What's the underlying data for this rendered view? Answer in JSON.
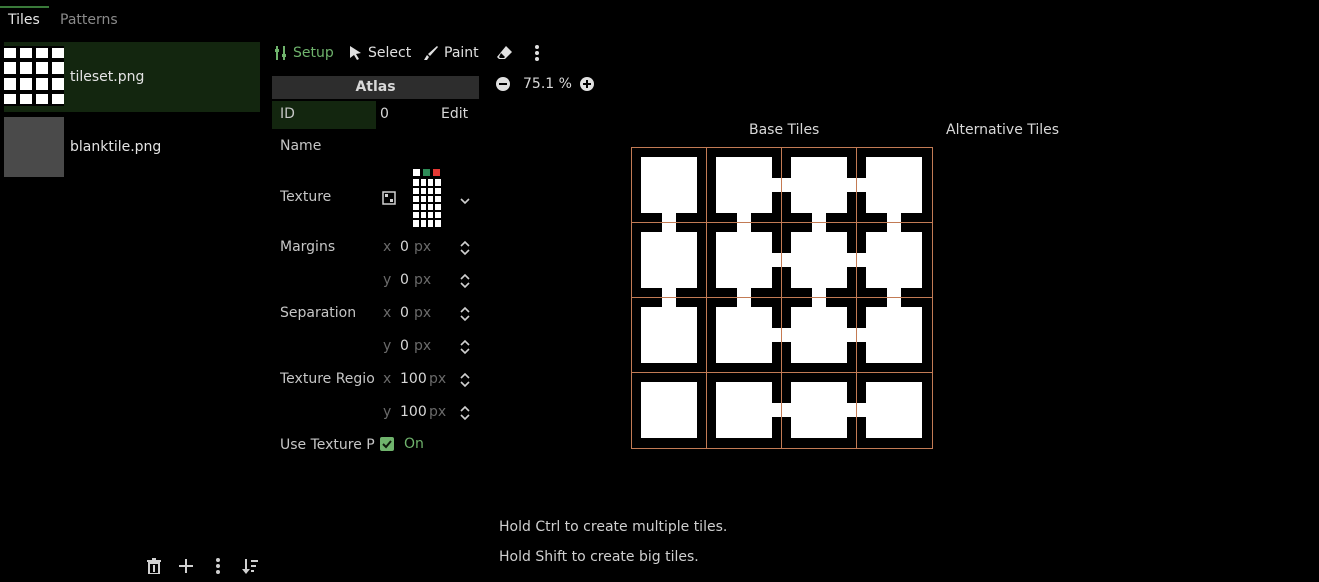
{
  "tabs": [
    {
      "label": "Tiles",
      "active": true
    },
    {
      "label": "Patterns",
      "active": false
    }
  ],
  "sources": [
    {
      "label": "tileset.png",
      "selected": true
    },
    {
      "label": "blanktile.png",
      "selected": false
    }
  ],
  "toolbar": {
    "setup": "Setup",
    "select": "Select",
    "paint": "Paint"
  },
  "zoom": {
    "value": "75.1 %"
  },
  "inspector": {
    "header": "Atlas",
    "id_label": "ID",
    "id_value": "0",
    "edit_label": "Edit",
    "name_label": "Name",
    "texture_label": "Texture",
    "margins_label": "Margins",
    "separation_label": "Separation",
    "texture_region_label": "Texture Regio",
    "use_texture_label": "Use Texture P",
    "use_texture_state": "On",
    "axis_x": "x",
    "axis_y": "y",
    "unit": "px",
    "margins": {
      "x": "0",
      "y": "0"
    },
    "separation": {
      "x": "0",
      "y": "0"
    },
    "texture_region": {
      "x": "100",
      "y": "100"
    }
  },
  "atlas_view": {
    "base_tiles_label": "Base Tiles",
    "alternative_tiles_label": "Alternative Tiles"
  },
  "hints": [
    "Hold Ctrl to create multiple tiles.",
    "Hold Shift to create big tiles."
  ],
  "colors": {
    "accent": "#6fb36c",
    "selected_bg": "#13260f",
    "grid": "#c27b55"
  }
}
